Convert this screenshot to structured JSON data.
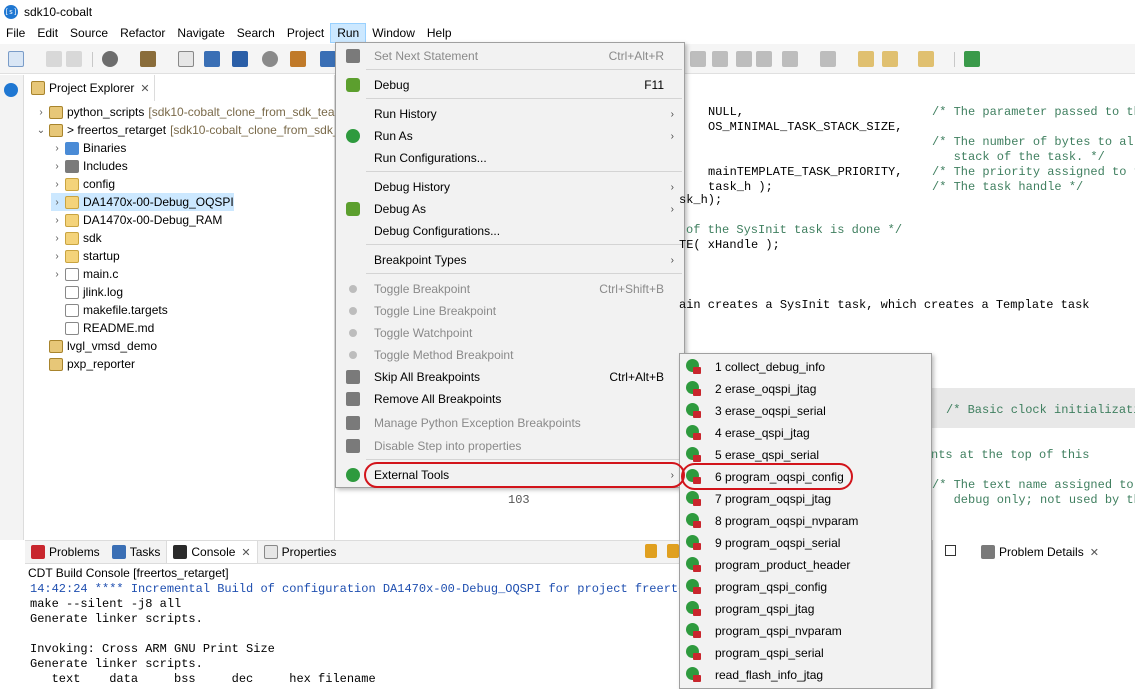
{
  "window": {
    "title": "sdk10-cobalt"
  },
  "menubar": [
    "File",
    "Edit",
    "Source",
    "Refactor",
    "Navigate",
    "Search",
    "Project",
    "Run",
    "Window",
    "Help"
  ],
  "project_explorer": {
    "tab_label": "Project Explorer",
    "items": [
      {
        "label": "python_scripts",
        "repo": "[sdk10-cobalt_clone_from_sdk_team",
        "kind": "proj",
        "chev": "›"
      },
      {
        "label": "> freertos_retarget",
        "repo": "[sdk10-cobalt_clone_from_sdk_te",
        "kind": "proj",
        "chev": "⌄"
      },
      {
        "label": "Binaries",
        "repo": "",
        "kind": "bin",
        "chev": "›"
      },
      {
        "label": "Includes",
        "repo": "",
        "kind": "inc",
        "chev": "›"
      },
      {
        "label": "config",
        "repo": "",
        "kind": "folder",
        "chev": "›"
      },
      {
        "label": "DA1470x-00-Debug_OQSPI",
        "repo": "",
        "kind": "folder",
        "chev": "›"
      },
      {
        "label": "DA1470x-00-Debug_RAM",
        "repo": "",
        "kind": "folder",
        "chev": "›"
      },
      {
        "label": "sdk",
        "repo": "",
        "kind": "folder",
        "chev": "›"
      },
      {
        "label": "startup",
        "repo": "",
        "kind": "folder",
        "chev": "›"
      },
      {
        "label": "main.c",
        "repo": "",
        "kind": "file",
        "chev": "›"
      },
      {
        "label": "jlink.log",
        "repo": "",
        "kind": "file",
        "chev": ""
      },
      {
        "label": "makefile.targets",
        "repo": "",
        "kind": "file",
        "chev": ""
      },
      {
        "label": "README.md",
        "repo": "",
        "kind": "file",
        "chev": ""
      },
      {
        "label": "lvgl_vmsd_demo",
        "repo": "",
        "kind": "proj",
        "chev": ""
      },
      {
        "label": "pxp_reporter",
        "repo": "",
        "kind": "proj",
        "chev": ""
      }
    ]
  },
  "run_menu": {
    "items": [
      {
        "label": "Set Next Statement",
        "accel": "Ctrl+Alt+R",
        "disabled": true,
        "arrow": false,
        "icon": "set-next-statement-icon"
      },
      {
        "label": "Debug",
        "accel": "F11",
        "disabled": false,
        "arrow": false,
        "icon": "debug-icon"
      },
      {
        "label": "Run History",
        "accel": "",
        "disabled": false,
        "arrow": true,
        "icon": ""
      },
      {
        "label": "Run As",
        "accel": "",
        "disabled": false,
        "arrow": true,
        "icon": "run-icon"
      },
      {
        "label": "Run Configurations...",
        "accel": "",
        "disabled": false,
        "arrow": false,
        "icon": ""
      },
      {
        "label": "Debug History",
        "accel": "",
        "disabled": false,
        "arrow": true,
        "icon": ""
      },
      {
        "label": "Debug As",
        "accel": "",
        "disabled": false,
        "arrow": true,
        "icon": "debug-as-icon"
      },
      {
        "label": "Debug Configurations...",
        "accel": "",
        "disabled": false,
        "arrow": false,
        "icon": ""
      },
      {
        "label": "Breakpoint Types",
        "accel": "",
        "disabled": false,
        "arrow": true,
        "icon": ""
      },
      {
        "label": "Toggle Breakpoint",
        "accel": "Ctrl+Shift+B",
        "disabled": true,
        "arrow": false,
        "icon": "breakpoint-dot-icon"
      },
      {
        "label": "Toggle Line Breakpoint",
        "accel": "",
        "disabled": true,
        "arrow": false,
        "icon": "breakpoint-dot-icon"
      },
      {
        "label": "Toggle Watchpoint",
        "accel": "",
        "disabled": true,
        "arrow": false,
        "icon": "watchpoint-icon"
      },
      {
        "label": "Toggle Method Breakpoint",
        "accel": "",
        "disabled": true,
        "arrow": false,
        "icon": "breakpoint-dot-icon"
      },
      {
        "label": "Skip All Breakpoints",
        "accel": "Ctrl+Alt+B",
        "disabled": false,
        "arrow": false,
        "icon": "skip-breakpoints-icon"
      },
      {
        "label": "Remove All Breakpoints",
        "accel": "",
        "disabled": false,
        "arrow": false,
        "icon": "remove-breakpoints-icon"
      },
      {
        "label": "Manage Python Exception Breakpoints",
        "accel": "",
        "disabled": true,
        "arrow": false,
        "icon": "python-exception-icon"
      },
      {
        "label": "Disable Step into properties",
        "accel": "",
        "disabled": true,
        "arrow": false,
        "icon": "step-into-icon"
      },
      {
        "label": "External Tools",
        "accel": "",
        "disabled": false,
        "arrow": true,
        "icon": "external-tools-icon"
      }
    ]
  },
  "external_tools": [
    "1 collect_debug_info",
    "2 erase_oqspi_jtag",
    "3 erase_oqspi_serial",
    "4 erase_qspi_jtag",
    "5 erase_qspi_serial",
    "6 program_oqspi_config",
    "7 program_oqspi_jtag",
    "8 program_oqspi_nvparam",
    "9 program_oqspi_serial",
    "program_product_header",
    "program_qspi_config",
    "program_qspi_jtag",
    "program_qspi_nvparam",
    "program_qspi_serial",
    "read_flash_info_jtag"
  ],
  "editor": {
    "lines": [
      {
        "code": "NULL,",
        "comment": "/* The parameter passed to th"
      },
      {
        "code": "OS_MINIMAL_TASK_STACK_SIZE,",
        "comment": ""
      },
      {
        "code": "",
        "comment": "/* The number of bytes to all"
      },
      {
        "code": "",
        "comment": "   stack of the task. */"
      },
      {
        "code": "mainTEMPLATE_TASK_PRIORITY,",
        "comment": "/* The priority assigned to t"
      },
      {
        "code": "task_h );",
        "comment": "/* The task handle */"
      }
    ],
    "fragments": [
      "sk_h);",
      "of the SysInit task is done */",
      "TE( xHandle );",
      "ain creates a SysInit task, which creates a Template task",
      "/* Basic clock initializati",
      "nts at the top of this",
      "/* The text name assigned to",
      "   debug only; not used by th",
      "103"
    ]
  },
  "bottom": {
    "tabs": [
      "Problems",
      "Tasks",
      "Console",
      "Properties"
    ],
    "console_title": "CDT Build Console [freertos_retarget]",
    "console_lines": [
      "14:42:24 **** Incremental Build of configuration DA1470x-00-Debug_OQSPI for project freertos_",
      "make --silent -j8 all",
      "Generate linker scripts.",
      "",
      "Invoking: Cross ARM GNU Print Size",
      "Generate linker scripts.",
      "   text    data     bss     dec     hex filename"
    ]
  },
  "problem_details": {
    "label": "Problem Details"
  },
  "colors": {
    "highlight": "#cce8ff",
    "annotation_red": "#d2141b",
    "tool_green": "#2e9a3e",
    "tool_red": "#c8262d"
  }
}
